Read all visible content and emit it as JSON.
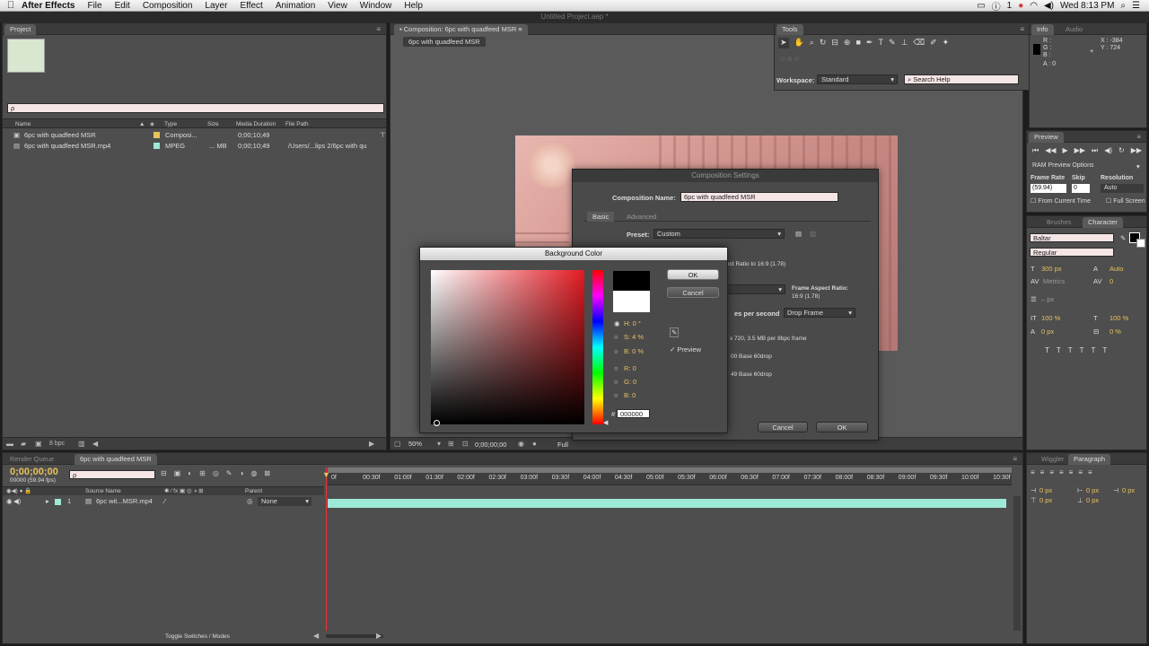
{
  "menubar": {
    "apple": "",
    "app": "After Effects",
    "items": [
      "File",
      "Edit",
      "Composition",
      "Layer",
      "Effect",
      "Animation",
      "View",
      "Window",
      "Help"
    ],
    "clock": "Wed 8:13 PM",
    "battery": "1"
  },
  "doc_title": "Untitled Project.aep *",
  "project": {
    "tab": "Project",
    "search_placeholder": "ρ",
    "columns": [
      "Name",
      "Type",
      "Size",
      "Media Duration",
      "File Path"
    ],
    "items": [
      {
        "name": "6pc with quadfeed MSR",
        "type": "Composi...",
        "size": "",
        "duration": "0;00;10;49",
        "path": "",
        "color": "#e8c25a"
      },
      {
        "name": "6pc with quadfeed MSR.mp4",
        "type": "MPEG",
        "size": "... MB",
        "duration": "0;00;10;49",
        "path": "/Users/...lips 2/6pc with qu",
        "color": "#9ee8d8"
      }
    ],
    "bpc": "8 bpc"
  },
  "composition": {
    "tab": "Composition: 6pc with quadfeed MSR",
    "subtab": "6pc with quadfeed MSR",
    "zoom": "50%",
    "timecode": "0;00;00;00",
    "resolution": "Full"
  },
  "tools": {
    "tab": "Tools",
    "workspace_label": "Workspace:",
    "workspace_value": "Standard",
    "search_help": "Search Help"
  },
  "info": {
    "tabs": [
      "Info",
      "Audio"
    ],
    "r": "R :",
    "g": "G :",
    "b": "B :",
    "a": "A : 0",
    "x": "X : -384",
    "y": "Y : 724"
  },
  "preview": {
    "tab": "Preview",
    "ram": "RAM Preview Options",
    "frame_rate_label": "Frame Rate",
    "skip_label": "Skip",
    "resolution_label": "Resolution",
    "frame_rate": "(59.94)",
    "skip": "0",
    "resolution": "Auto",
    "from_current": "From Current Time",
    "full_screen": "Full Screen"
  },
  "character": {
    "tabs": [
      "Brushes",
      "Character"
    ],
    "font": "Baltar",
    "style": "Regular",
    "size": "300 px",
    "leading": "Auto",
    "kerning": "Metrics",
    "tracking": "0",
    "stroke": "– px",
    "vscale": "100 %",
    "hscale": "100 %",
    "baseline": "0 px",
    "tsume": "0 %"
  },
  "paragraph": {
    "tabs": [
      "Wiggler",
      "Paragraph"
    ],
    "values": [
      "0 px",
      "0 px",
      "0 px",
      "0 px",
      "0 px"
    ]
  },
  "comp_settings": {
    "title": "Composition Settings",
    "name_label": "Composition Name:",
    "name_value": "6pc with quadfeed MSR",
    "tabs": [
      "Basic",
      "Advanced"
    ],
    "preset_label": "Preset:",
    "preset_value": "Custom",
    "lock_text": "ect Ratio to 16:9 (1.78)",
    "frame_aspect_label": "Frame Aspect Ratio:",
    "frame_aspect_value": "16:9 (1.78)",
    "fps_label": "es per second",
    "drop_frame": "Drop Frame",
    "size_info": "x 720, 3.5 MB per 8bpc frame",
    "start": "00  Base 60drop",
    "duration": "49  Base 60drop",
    "cancel": "Cancel",
    "ok": "OK"
  },
  "bg_color": {
    "title": "Background Color",
    "ok": "OK",
    "cancel": "Cancel",
    "h": "H: 0 °",
    "s": "S: 4 %",
    "b": "B: 0 %",
    "r": "R: 0",
    "g": "G: 0",
    "bl": "B: 0",
    "hex_label": "#",
    "hex": "000000",
    "preview": "Preview"
  },
  "timeline": {
    "tabs": [
      "Render Queue",
      "6pc with quadfeed MSR"
    ],
    "timecode": "0;00;00;00",
    "fps": "00000 (59.94 fps)",
    "search_placeholder": "ρ",
    "source_name": "Source Name",
    "parent": "Parent",
    "layer_num": "1",
    "layer_name": "6pc wit...MSR.mp4",
    "parent_value": "None",
    "toggle": "Toggle Switches / Modes",
    "ruler": [
      "0f",
      "00:30f",
      "01:00f",
      "01:30f",
      "02:00f",
      "02:30f",
      "03:00f",
      "03:30f",
      "04:00f",
      "04:30f",
      "05:00f",
      "05:30f",
      "06:00f",
      "06:30f",
      "07:00f",
      "07:30f",
      "08:00f",
      "08:30f",
      "09:00f",
      "09:30f",
      "10:00f",
      "10:30f"
    ]
  }
}
